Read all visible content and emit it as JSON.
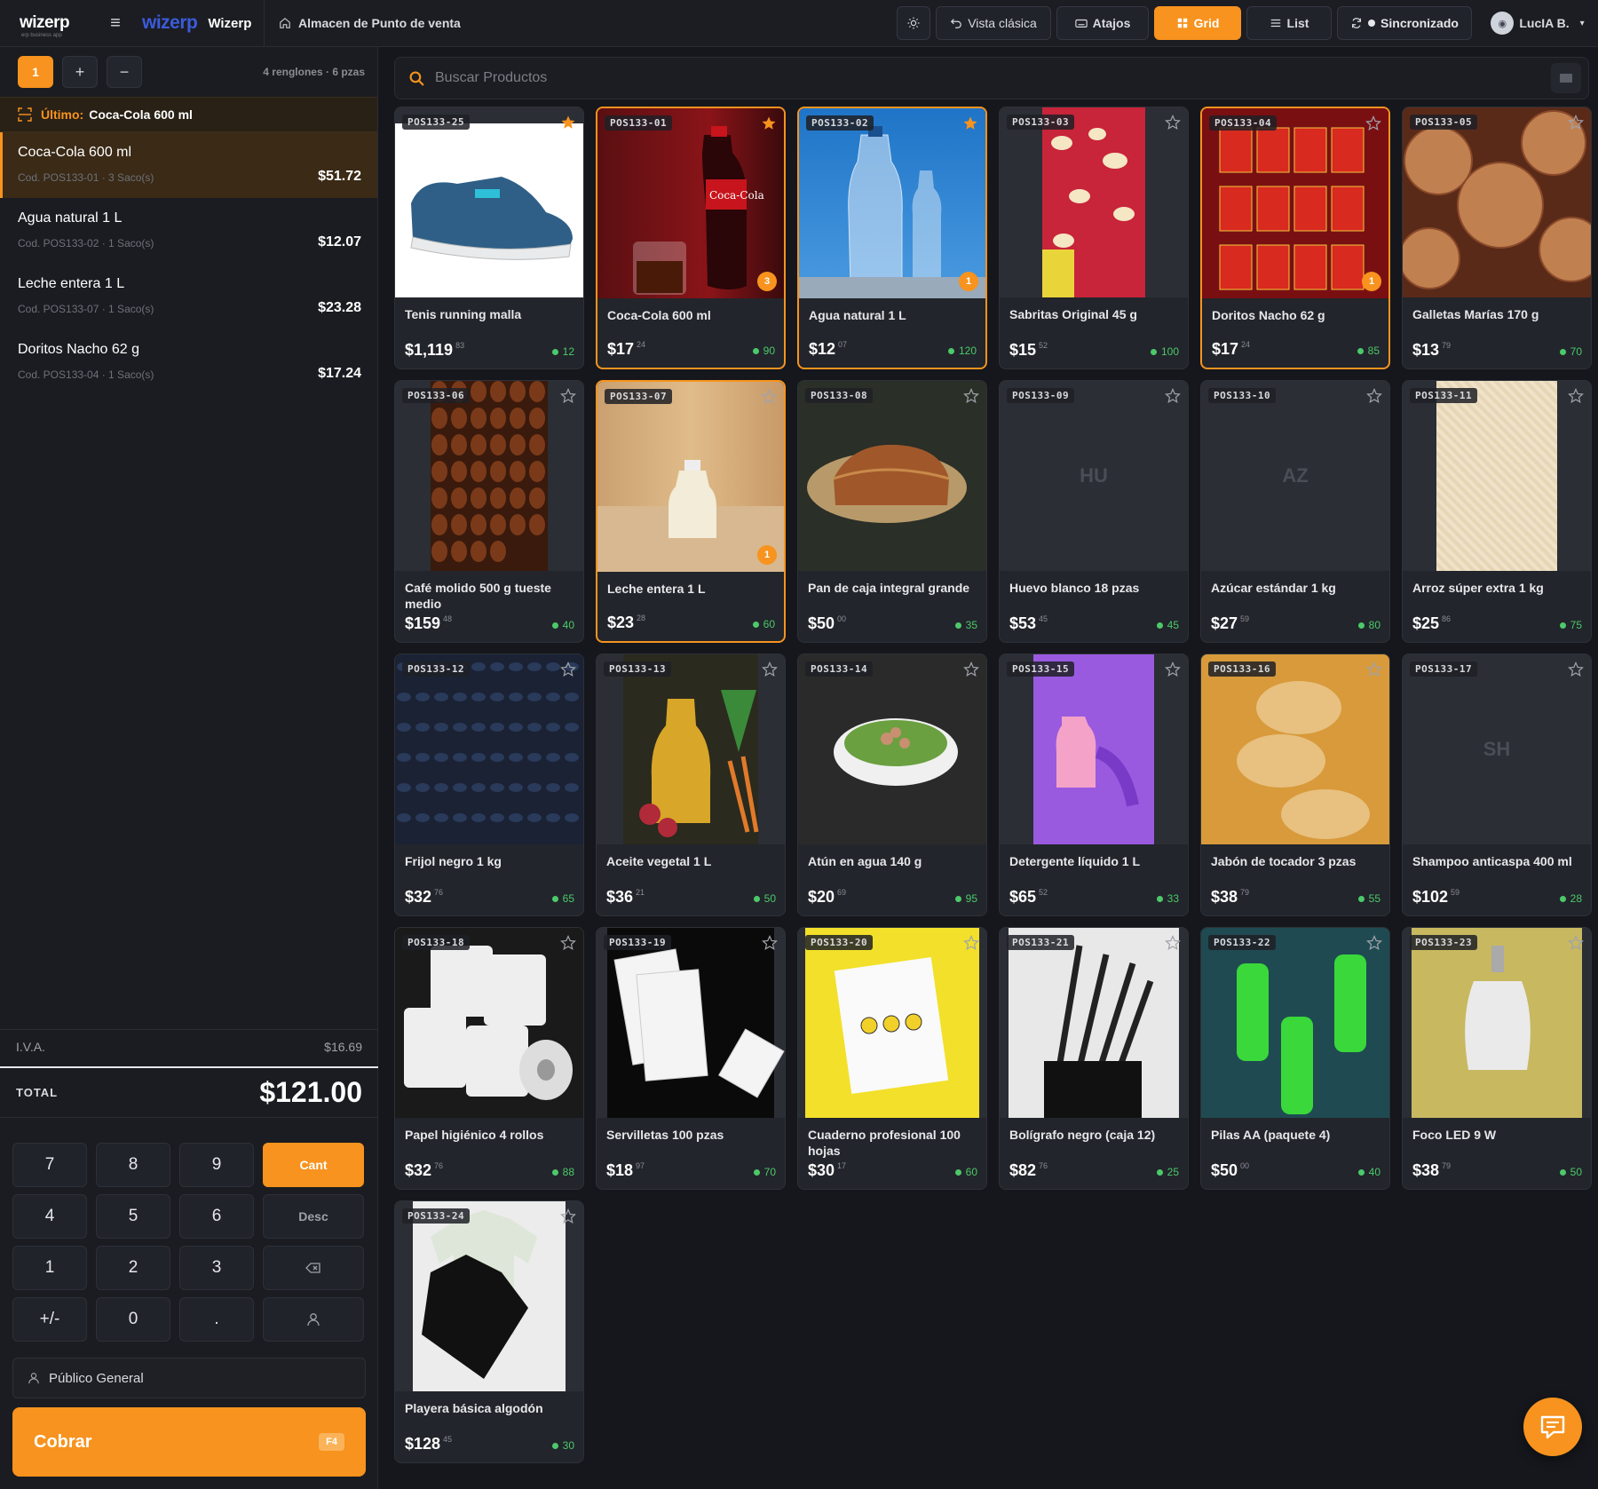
{
  "topbar": {
    "brand": "wizerp",
    "brand_tagline": "erp business app",
    "brand2_logo": "wizerp",
    "brand2_name": "Wizerp",
    "store": "Almacen de Punto de venta",
    "theme_icon": "sun-icon",
    "classic_view": "Vista clásica",
    "shortcuts": "Atajos",
    "grid": "Grid",
    "list": "List",
    "sync": "Sincronizado",
    "user": "LucIA B.",
    "colors": {
      "accent": "#f7931e",
      "bg": "#15171c",
      "panel": "#1a1c21"
    }
  },
  "tickets": {
    "active": "1",
    "add": "+",
    "remove": "−",
    "info": "4 renglones · 6 pzas"
  },
  "last_added": {
    "label": "Último:",
    "value": "Coca-Cola 600 ml"
  },
  "cart": [
    {
      "name": "Coca-Cola 600 ml",
      "code": "Cod. POS133-01 · 3 Saco(s)",
      "price": "$51.72"
    },
    {
      "name": "Agua natural 1 L",
      "code": "Cod. POS133-02 · 1 Saco(s)",
      "price": "$12.07"
    },
    {
      "name": "Leche entera 1 L",
      "code": "Cod. POS133-07 · 1 Saco(s)",
      "price": "$23.28"
    },
    {
      "name": "Doritos Nacho 62 g",
      "code": "Cod. POS133-04 · 1 Saco(s)",
      "price": "$17.24"
    }
  ],
  "summary": {
    "iva_label": "I.V.A.",
    "iva": "$16.69",
    "total_label": "TOTAL",
    "total": "$121.00"
  },
  "keypad": [
    "7",
    "8",
    "9",
    "Cant",
    "4",
    "5",
    "6",
    "Desc",
    "1",
    "2",
    "3",
    "backspace",
    "+/-",
    "0",
    ".",
    "customer"
  ],
  "customer": "Público General",
  "charge": {
    "label": "Cobrar",
    "shortcut": "F4"
  },
  "search": {
    "placeholder": "Buscar Productos"
  },
  "products": [
    {
      "code": "POS133-25",
      "name": "Tenis running malla",
      "price": "$1,119",
      "cents": "83",
      "stock": "12",
      "fav": true,
      "qty": "",
      "img": "shoe"
    },
    {
      "code": "POS133-01",
      "name": "Coca-Cola 600 ml",
      "price": "$17",
      "cents": "24",
      "stock": "90",
      "fav": true,
      "qty": "3",
      "img": "cola"
    },
    {
      "code": "POS133-02",
      "name": "Agua natural 1 L",
      "price": "$12",
      "cents": "07",
      "stock": "120",
      "fav": true,
      "qty": "1",
      "img": "water"
    },
    {
      "code": "POS133-03",
      "name": "Sabritas Original 45 g",
      "price": "$15",
      "cents": "52",
      "stock": "100",
      "fav": false,
      "qty": "",
      "img": "chips"
    },
    {
      "code": "POS133-04",
      "name": "Doritos Nacho 62 g",
      "price": "$17",
      "cents": "24",
      "stock": "85",
      "fav": false,
      "qty": "1",
      "img": "doritos"
    },
    {
      "code": "POS133-05",
      "name": "Galletas Marías 170 g",
      "price": "$13",
      "cents": "79",
      "stock": "70",
      "fav": false,
      "qty": "",
      "img": "cookies"
    },
    {
      "code": "POS133-06",
      "name": "Café molido 500 g tueste medio",
      "price": "$159",
      "cents": "48",
      "stock": "40",
      "fav": false,
      "qty": "",
      "img": "coffee"
    },
    {
      "code": "POS133-07",
      "name": "Leche entera 1 L",
      "price": "$23",
      "cents": "28",
      "stock": "60",
      "fav": false,
      "qty": "1",
      "img": "milk"
    },
    {
      "code": "POS133-08",
      "name": "Pan de caja integral grande",
      "price": "$50",
      "cents": "00",
      "stock": "35",
      "fav": false,
      "qty": "",
      "img": "bread"
    },
    {
      "code": "POS133-09",
      "name": "Huevo blanco 18 pzas",
      "price": "$53",
      "cents": "45",
      "stock": "45",
      "fav": false,
      "qty": "",
      "img": "",
      "initials": "HU"
    },
    {
      "code": "POS133-10",
      "name": "Azúcar estándar 1 kg",
      "price": "$27",
      "cents": "59",
      "stock": "80",
      "fav": false,
      "qty": "",
      "img": "",
      "initials": "AZ"
    },
    {
      "code": "POS133-11",
      "name": "Arroz súper extra 1 kg",
      "price": "$25",
      "cents": "86",
      "stock": "75",
      "fav": false,
      "qty": "",
      "img": "rice"
    },
    {
      "code": "POS133-12",
      "name": "Frijol negro 1 kg",
      "price": "$32",
      "cents": "76",
      "stock": "65",
      "fav": false,
      "qty": "",
      "img": "beans"
    },
    {
      "code": "POS133-13",
      "name": "Aceite vegetal 1 L",
      "price": "$36",
      "cents": "21",
      "stock": "50",
      "fav": false,
      "qty": "",
      "img": "oil"
    },
    {
      "code": "POS133-14",
      "name": "Atún en agua 140 g",
      "price": "$20",
      "cents": "69",
      "stock": "95",
      "fav": false,
      "qty": "",
      "img": "salad"
    },
    {
      "code": "POS133-15",
      "name": "Detergente líquido 1 L",
      "price": "$65",
      "cents": "52",
      "stock": "33",
      "fav": false,
      "qty": "",
      "img": "detergent"
    },
    {
      "code": "POS133-16",
      "name": "Jabón de tocador 3 pzas",
      "price": "$38",
      "cents": "79",
      "stock": "55",
      "fav": false,
      "qty": "",
      "img": "soap"
    },
    {
      "code": "POS133-17",
      "name": "Shampoo anticaspa 400 ml",
      "price": "$102",
      "cents": "59",
      "stock": "28",
      "fav": false,
      "qty": "",
      "img": "",
      "initials": "SH"
    },
    {
      "code": "POS133-18",
      "name": "Papel higiénico 4 rollos",
      "price": "$32",
      "cents": "76",
      "stock": "88",
      "fav": false,
      "qty": "",
      "img": "tp"
    },
    {
      "code": "POS133-19",
      "name": "Servilletas 100 pzas",
      "price": "$18",
      "cents": "97",
      "stock": "70",
      "fav": false,
      "qty": "",
      "img": "napkins"
    },
    {
      "code": "POS133-20",
      "name": "Cuaderno profesional 100 hojas",
      "price": "$30",
      "cents": "17",
      "stock": "60",
      "fav": false,
      "qty": "",
      "img": "notebook"
    },
    {
      "code": "POS133-21",
      "name": "Bolígrafo negro (caja 12)",
      "price": "$82",
      "cents": "76",
      "stock": "25",
      "fav": false,
      "qty": "",
      "img": "pens"
    },
    {
      "code": "POS133-22",
      "name": "Pilas AA (paquete 4)",
      "price": "$50",
      "cents": "00",
      "stock": "40",
      "fav": false,
      "qty": "",
      "img": "batteries"
    },
    {
      "code": "POS133-23",
      "name": "Foco LED 9 W",
      "price": "$38",
      "cents": "79",
      "stock": "50",
      "fav": false,
      "qty": "",
      "img": "bulb"
    },
    {
      "code": "POS133-24",
      "name": "Playera básica algodón",
      "price": "$128",
      "cents": "45",
      "stock": "30",
      "fav": false,
      "qty": "",
      "img": "shirt"
    }
  ],
  "selected_products": [
    "POS133-01",
    "POS133-02",
    "POS133-04",
    "POS133-07"
  ],
  "chat_icon": "chat-icon"
}
